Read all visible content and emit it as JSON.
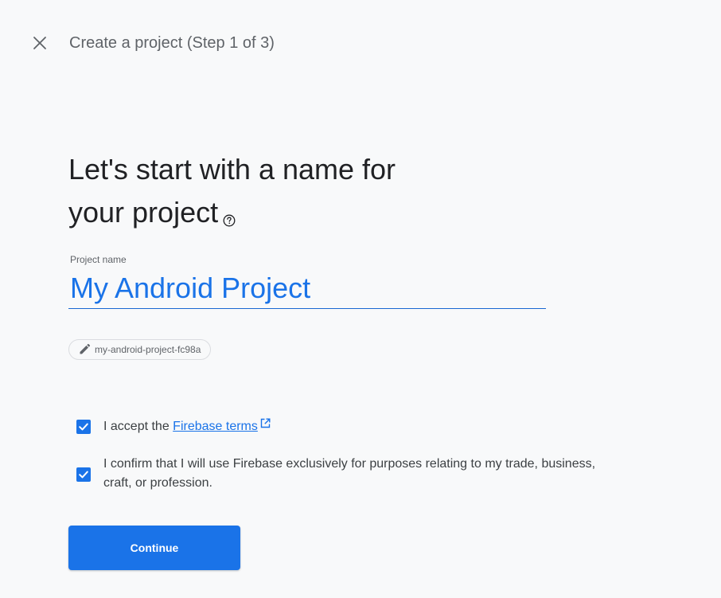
{
  "header": {
    "step_title": "Create a project (Step 1 of 3)"
  },
  "main": {
    "heading_line1": "Let's start with a name for",
    "heading_line2": "your project",
    "project_name": {
      "label": "Project name",
      "value": "My Android Project"
    },
    "project_id": "my-android-project-fc98a",
    "checkboxes": [
      {
        "checked": true,
        "text_prefix": "I accept the ",
        "link_text": "Firebase terms"
      },
      {
        "checked": true,
        "text": "I confirm that I will use Firebase exclusively for purposes relating to my trade, business, craft, or profession."
      }
    ],
    "continue_label": "Continue"
  },
  "colors": {
    "accent": "#1a73e8",
    "background": "#f8f9fa",
    "text_primary": "#202124",
    "text_secondary": "#5f6368"
  },
  "icons": {
    "close": "close-icon",
    "help": "help-circle-icon",
    "edit": "pencil-icon",
    "external": "open-in-new-icon",
    "check": "check-icon"
  }
}
